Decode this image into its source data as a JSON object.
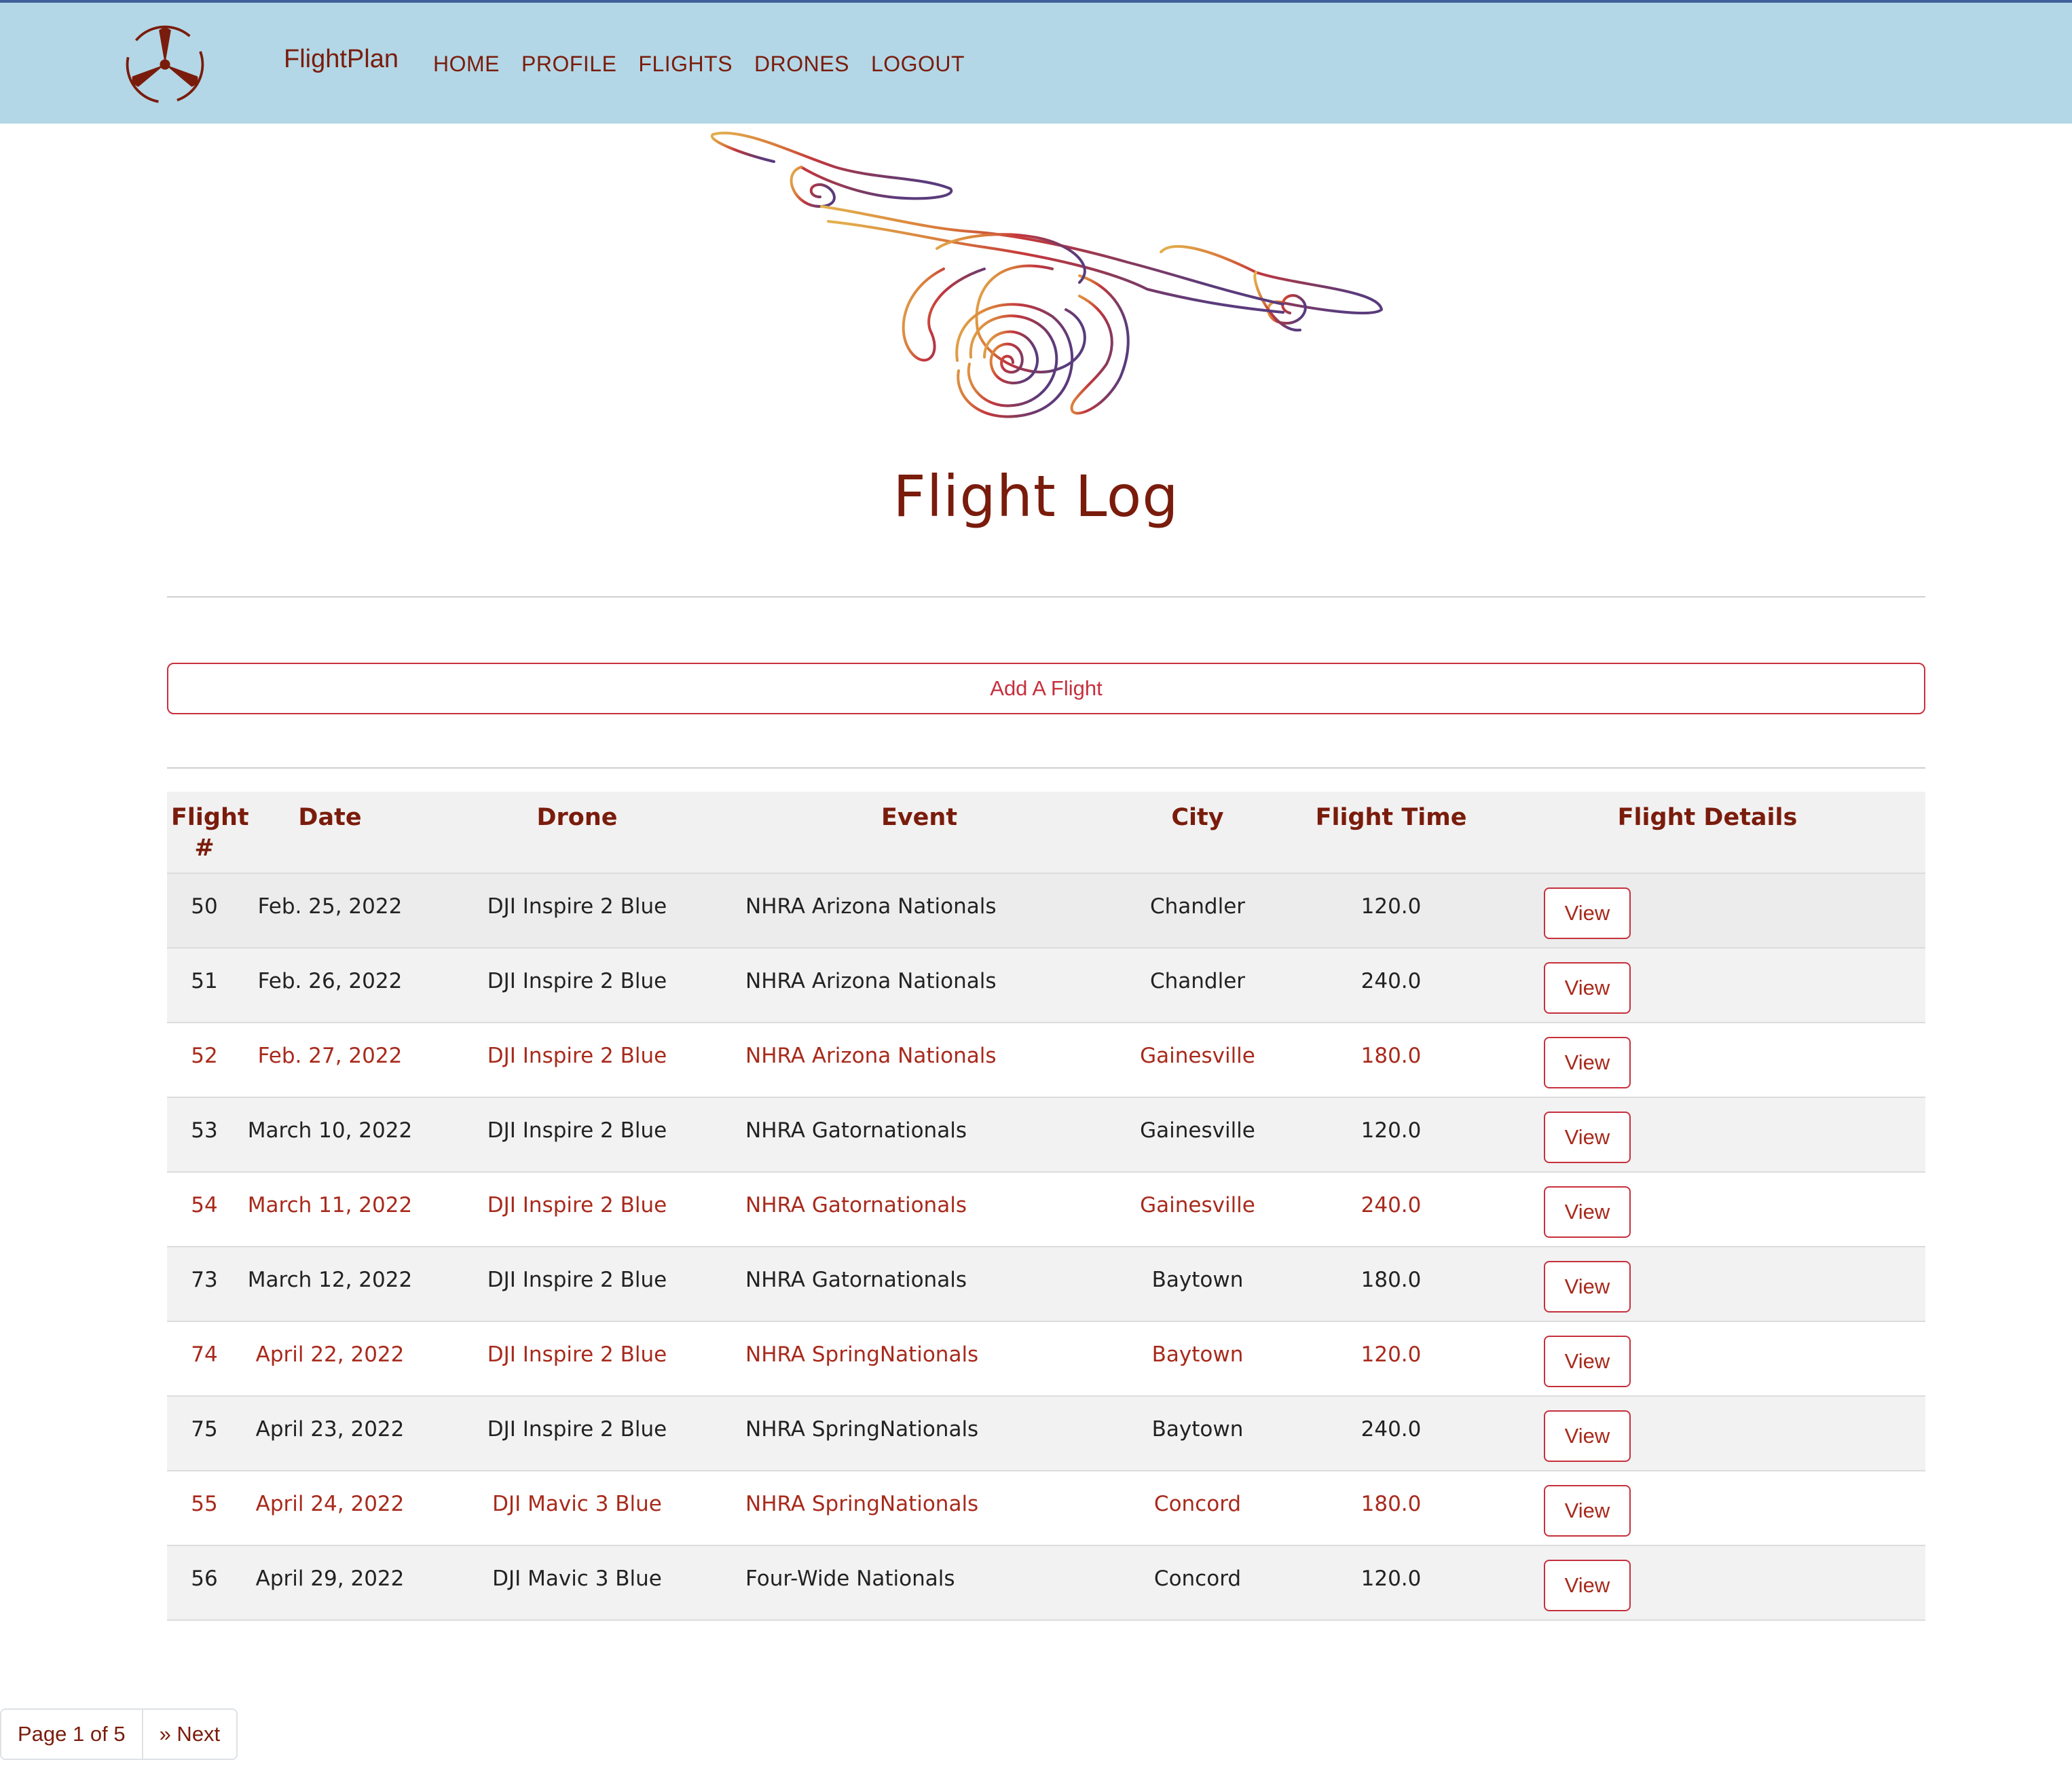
{
  "navbar": {
    "brand": "FlightPlan",
    "links": [
      "HOME",
      "PROFILE",
      "FLIGHTS",
      "DRONES",
      "LOGOUT"
    ],
    "logo_icon": "propeller-icon",
    "background": "#b3d7e6",
    "accent": "#7a1c0c"
  },
  "hero": {
    "art_icon": "drone-line-art",
    "title": "Flight Log"
  },
  "actions": {
    "add_flight": "Add A Flight",
    "button_color": "#c6303d"
  },
  "table": {
    "headers": [
      "Flight #",
      "Date",
      "Drone",
      "Event",
      "City",
      "Flight Time",
      "Flight Details"
    ],
    "view_label": "View",
    "rows": [
      {
        "flight": "50",
        "date": "Feb. 25, 2022",
        "drone": "DJI Inspire 2 Blue",
        "event": "NHRA Arizona Nationals",
        "city": "Chandler",
        "time": "120.0",
        "highlighted": false
      },
      {
        "flight": "51",
        "date": "Feb. 26, 2022",
        "drone": "DJI Inspire 2 Blue",
        "event": "NHRA Arizona Nationals",
        "city": "Chandler",
        "time": "240.0",
        "highlighted": false
      },
      {
        "flight": "52",
        "date": "Feb. 27, 2022",
        "drone": "DJI Inspire 2 Blue",
        "event": "NHRA Arizona Nationals",
        "city": "Gainesville",
        "time": "180.0",
        "highlighted": true
      },
      {
        "flight": "53",
        "date": "March 10, 2022",
        "drone": "DJI Inspire 2 Blue",
        "event": "NHRA Gatornationals",
        "city": "Gainesville",
        "time": "120.0",
        "highlighted": false
      },
      {
        "flight": "54",
        "date": "March 11, 2022",
        "drone": "DJI Inspire 2 Blue",
        "event": "NHRA Gatornationals",
        "city": "Gainesville",
        "time": "240.0",
        "highlighted": true
      },
      {
        "flight": "73",
        "date": "March 12, 2022",
        "drone": "DJI Inspire 2 Blue",
        "event": "NHRA Gatornationals",
        "city": "Baytown",
        "time": "180.0",
        "highlighted": false
      },
      {
        "flight": "74",
        "date": "April 22, 2022",
        "drone": "DJI Inspire 2 Blue",
        "event": "NHRA SpringNationals",
        "city": "Baytown",
        "time": "120.0",
        "highlighted": true
      },
      {
        "flight": "75",
        "date": "April 23, 2022",
        "drone": "DJI Inspire 2 Blue",
        "event": "NHRA SpringNationals",
        "city": "Baytown",
        "time": "240.0",
        "highlighted": false
      },
      {
        "flight": "55",
        "date": "April 24, 2022",
        "drone": "DJI Mavic 3 Blue",
        "event": "NHRA SpringNationals",
        "city": "Concord",
        "time": "180.0",
        "highlighted": true
      },
      {
        "flight": "56",
        "date": "April 29, 2022",
        "drone": "DJI Mavic 3 Blue",
        "event": "Four-Wide Nationals",
        "city": "Concord",
        "time": "120.0",
        "highlighted": false
      }
    ]
  },
  "pagination": {
    "info": "Page 1 of 5",
    "next": "» Next"
  }
}
